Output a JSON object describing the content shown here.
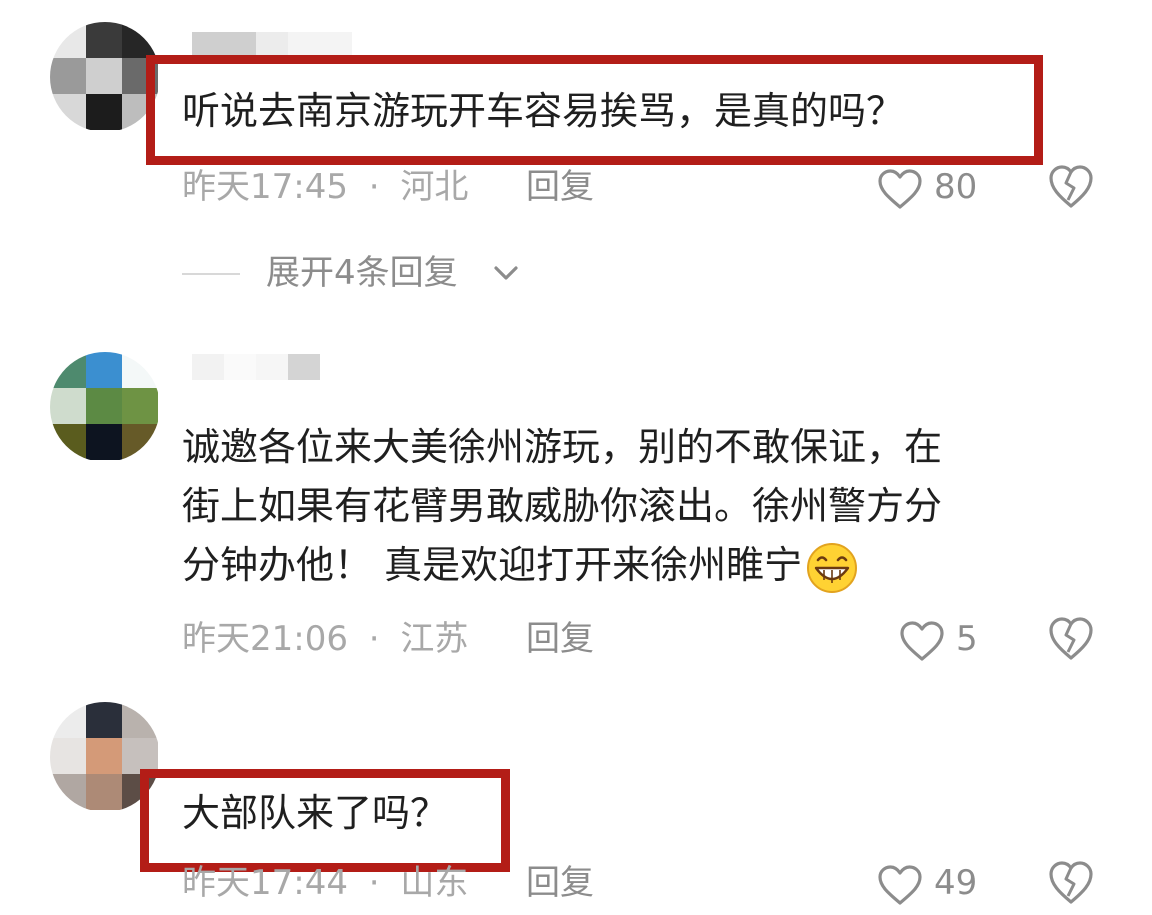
{
  "comments": [
    {
      "text_lines": [
        "听说去南京游玩开车容易挨骂，是真的吗？"
      ],
      "time": "昨天17:45",
      "sep": "·",
      "location": "河北",
      "reply_label": "回复",
      "likes": "80",
      "expand_label": "展开4条回复",
      "highlighted": true
    },
    {
      "text_lines": [
        "诚邀各位来大美徐州游玩，别的不敢保证，在",
        "街上如果有花臂男敢威胁你滚出。徐州警方分",
        "分钟办他！ 真是欢迎打开来徐州睢宁"
      ],
      "time": "昨天21:06",
      "sep": "·",
      "location": "江苏",
      "reply_label": "回复",
      "likes": "5",
      "highlighted": false
    },
    {
      "text_lines": [
        "大部队来了吗？"
      ],
      "time": "昨天17:44",
      "sep": "·",
      "location": "山东",
      "reply_label": "回复",
      "likes": "49",
      "highlighted": true
    }
  ],
  "colors": {
    "highlight_border": "#b31d17",
    "meta_text": "#a8a8a8",
    "body_text": "#1f1f1f"
  },
  "icons": {
    "like": "heart-outline-icon",
    "dislike": "broken-heart-icon",
    "expand": "chevron-down-icon",
    "emoji": "grinning-face-emoji"
  }
}
